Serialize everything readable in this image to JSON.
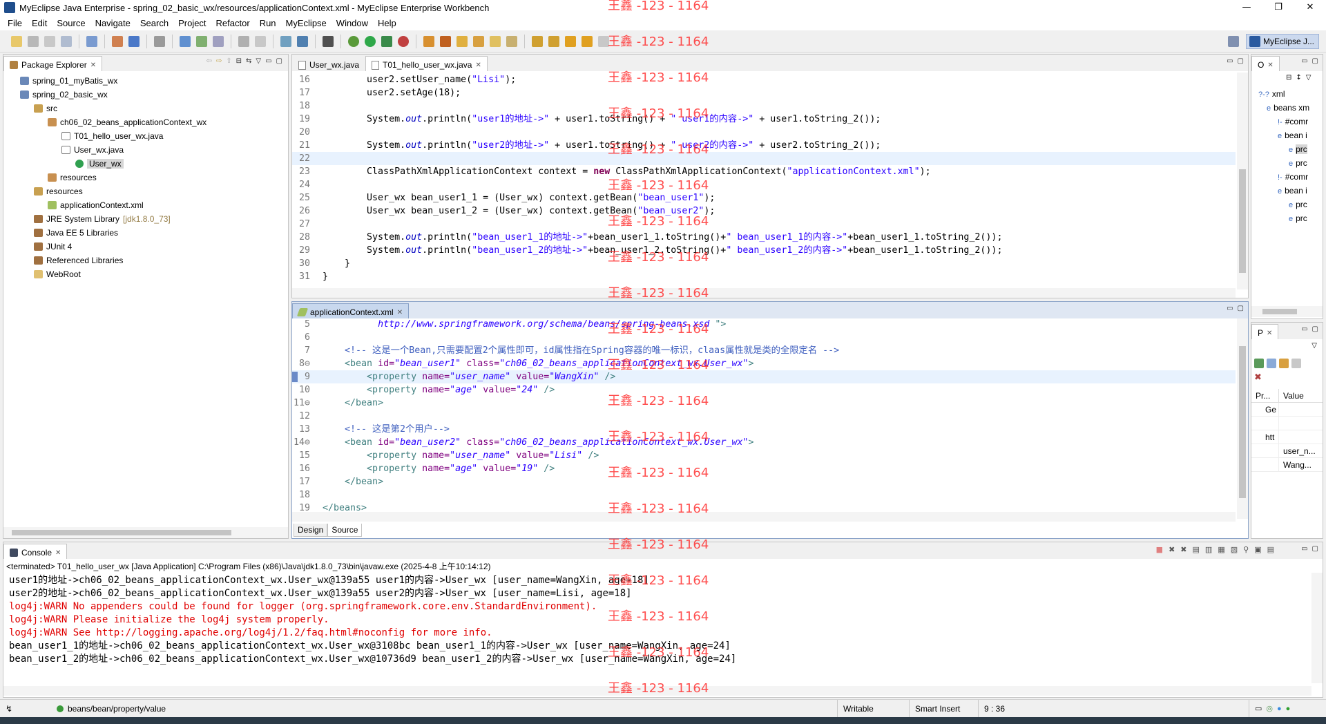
{
  "window": {
    "title": "MyEclipse Java Enterprise - spring_02_basic_wx/resources/applicationContext.xml - MyEclipse Enterprise Workbench",
    "minimize": "—",
    "maximize": "❐",
    "close": "✕"
  },
  "menu": [
    "File",
    "Edit",
    "Source",
    "Navigate",
    "Search",
    "Project",
    "Refactor",
    "Run",
    "MyEclipse",
    "Window",
    "Help"
  ],
  "perspective": {
    "label": "MyEclipse J..."
  },
  "package_explorer": {
    "title": "Package Explorer",
    "items": [
      {
        "label": "spring_01_myBatis_wx",
        "icon": "project-icon",
        "indent": 0
      },
      {
        "label": "spring_02_basic_wx",
        "icon": "project-icon",
        "indent": 0
      },
      {
        "label": "src",
        "icon": "source-folder-icon",
        "indent": 1
      },
      {
        "label": "ch06_02_beans_applicationContext_wx",
        "icon": "package-icon",
        "indent": 2
      },
      {
        "label": "T01_hello_user_wx.java",
        "icon": "java-file-icon",
        "indent": 3
      },
      {
        "label": "User_wx.java",
        "icon": "java-file-icon",
        "indent": 3
      },
      {
        "label": "User_wx",
        "icon": "class-icon",
        "indent": 4,
        "selected": true
      },
      {
        "label": "resources",
        "icon": "package-icon",
        "indent": 2
      },
      {
        "label": "resources",
        "icon": "source-folder-icon",
        "indent": 1
      },
      {
        "label": "applicationContext.xml",
        "icon": "xml-file-icon",
        "indent": 2
      },
      {
        "label": "JRE System Library",
        "suffix": "[jdk1.8.0_73]",
        "icon": "library-icon",
        "indent": 1
      },
      {
        "label": "Java EE 5 Libraries",
        "icon": "library-icon",
        "indent": 1
      },
      {
        "label": "JUnit 4",
        "icon": "library-icon",
        "indent": 1
      },
      {
        "label": "Referenced Libraries",
        "icon": "library-icon",
        "indent": 1
      },
      {
        "label": "WebRoot",
        "icon": "folder-icon",
        "indent": 1
      }
    ]
  },
  "java_editor": {
    "tabs": [
      "User_wx.java",
      "T01_hello_user_wx.java"
    ],
    "lines": [
      {
        "n": "16",
        "html": "        user2.setUser_name(<span class=\"str\">\"Lisi\"</span>);"
      },
      {
        "n": "17",
        "html": "        user2.setAge(18);"
      },
      {
        "n": "18",
        "html": ""
      },
      {
        "n": "19",
        "html": "        System.<span class=\"it\">out</span>.println(<span class=\"str\">\"user1的地址->\"</span> + user1.toString() + <span class=\"str\">\" user1的内容->\"</span> + user1.toString_2());"
      },
      {
        "n": "20",
        "html": ""
      },
      {
        "n": "21",
        "html": "        System.<span class=\"it\">out</span>.println(<span class=\"str\">\"user2的地址->\"</span> + user1.toString() + <span class=\"str\">\" user2的内容->\"</span> + user2.toString_2());"
      },
      {
        "n": "22",
        "html": "",
        "current": true
      },
      {
        "n": "23",
        "html": "        ClassPathXmlApplicationContext context = <span class=\"kw\">new</span> ClassPathXmlApplicationContext(<span class=\"str\">\"applicationContext.xml\"</span>);"
      },
      {
        "n": "24",
        "html": ""
      },
      {
        "n": "25",
        "html": "        User_wx bean_user1_1 = (User_wx) context.getBean(<span class=\"str\">\"bean_user1\"</span>);"
      },
      {
        "n": "26",
        "html": "        User_wx bean_user1_2 = (User_wx) context.getBean(<span class=\"str\">\"bean_user2\"</span>);"
      },
      {
        "n": "27",
        "html": ""
      },
      {
        "n": "28",
        "html": "        System.<span class=\"it\">out</span>.println(<span class=\"str\">\"bean_user1_1的地址->\"</span>+bean_user1_1.toString()+<span class=\"str\">\" bean_user1_1的内容->\"</span>+bean_user1_1.toString_2());"
      },
      {
        "n": "29",
        "html": "        System.<span class=\"it\">out</span>.println(<span class=\"str\">\"bean_user1_2的地址->\"</span>+bean_user1_2.toString()+<span class=\"str\">\" bean_user1_2的内容->\"</span>+bean_user1_1.toString_2());"
      },
      {
        "n": "30",
        "html": "    }"
      },
      {
        "n": "31",
        "html": "}"
      }
    ]
  },
  "xml_editor": {
    "tab": "applicationContext.xml",
    "lines": [
      {
        "n": "5",
        "html": "          <span class=\"val\">http://www.springframework.org/schema/beans/spring-beans.xsd</span> <span class=\"tagc\">\"&gt;</span>"
      },
      {
        "n": "6",
        "html": ""
      },
      {
        "n": "7",
        "html": "    <span class=\"xcm\">&lt;!-- 这是一个Bean,只需要配置2个属性即可，id属性指在Spring容器的唯一标识，claas属性就是类的全限定名 --&gt;</span>"
      },
      {
        "n": "8",
        "fold": true,
        "html": "    <span class=\"tagc\">&lt;bean</span> <span class=\"attr\">id=</span><span class=\"val\">\"bean_user1\"</span> <span class=\"attr\">class=</span><span class=\"val\">\"ch06_02_beans_applicationContext_wx.User_wx\"</span><span class=\"tagc\">&gt;</span>"
      },
      {
        "n": "9",
        "current": true,
        "html": "        <span class=\"tagc\">&lt;property</span> <span class=\"attr\">name=</span><span class=\"val\">\"user_name\"</span> <span class=\"attr\">value=</span><span class=\"val\">\"WangXin\"</span> <span class=\"tagc\">/&gt;</span>"
      },
      {
        "n": "10",
        "html": "        <span class=\"tagc\">&lt;property</span> <span class=\"attr\">name=</span><span class=\"val\">\"age\"</span> <span class=\"attr\">value=</span><span class=\"val\">\"24\"</span> <span class=\"tagc\">/&gt;</span>"
      },
      {
        "n": "11",
        "fold": true,
        "html": "    <span class=\"tagc\">&lt;/bean&gt;</span>"
      },
      {
        "n": "12",
        "html": ""
      },
      {
        "n": "13",
        "html": "    <span class=\"xcm\">&lt;!-- 这是第2个用户--&gt;</span>"
      },
      {
        "n": "14",
        "fold": true,
        "html": "    <span class=\"tagc\">&lt;bean</span> <span class=\"attr\">id=</span><span class=\"val\">\"bean_user2\"</span> <span class=\"attr\">class=</span><span class=\"val\">\"ch06_02_beans_applicationContext_wx.User_wx\"</span><span class=\"tagc\">&gt;</span>"
      },
      {
        "n": "15",
        "html": "        <span class=\"tagc\">&lt;property</span> <span class=\"attr\">name=</span><span class=\"val\">\"user_name\"</span> <span class=\"attr\">value=</span><span class=\"val\">\"Lisi\"</span> <span class=\"tagc\">/&gt;</span>"
      },
      {
        "n": "16",
        "html": "        <span class=\"tagc\">&lt;property</span> <span class=\"attr\">name=</span><span class=\"val\">\"age\"</span> <span class=\"attr\">value=</span><span class=\"val\">\"19\"</span> <span class=\"tagc\">/&gt;</span>"
      },
      {
        "n": "17",
        "html": "    <span class=\"tagc\">&lt;/bean&gt;</span>"
      },
      {
        "n": "18",
        "html": ""
      },
      {
        "n": "19",
        "html": "<span class=\"tagc\">&lt;/beans&gt;</span>"
      }
    ],
    "bottom_tabs": [
      "Design",
      "Source"
    ]
  },
  "outline": {
    "title": "O",
    "items": [
      {
        "label": "xml",
        "prefix": "?-?"
      },
      {
        "label": "beans xm",
        "prefix": "e"
      },
      {
        "label": "#comr",
        "prefix": "!-"
      },
      {
        "label": "bean i",
        "prefix": "e"
      },
      {
        "label": "prc",
        "prefix": "e",
        "selected": true
      },
      {
        "label": "prc",
        "prefix": "e"
      },
      {
        "label": "#comr",
        "prefix": "!-"
      },
      {
        "label": "bean i",
        "prefix": "e"
      },
      {
        "label": "prc",
        "prefix": "e"
      },
      {
        "label": "prc",
        "prefix": "e"
      }
    ]
  },
  "properties": {
    "title": "P",
    "col_property": "Pr...",
    "col_value": "Value",
    "rows": [
      {
        "prop": "Ge",
        "value": ""
      },
      {
        "prop": "",
        "value": ""
      },
      {
        "prop": "htt",
        "value": ""
      },
      {
        "prop": "",
        "value": "user_n..."
      },
      {
        "prop": "",
        "value": "Wang..."
      }
    ]
  },
  "console": {
    "title": "Console",
    "header": "<terminated> T01_hello_user_wx [Java Application] C:\\Program Files (x86)\\Java\\jdk1.8.0_73\\bin\\javaw.exe (2025-4-8 上午10:14:12)",
    "lines": [
      {
        "text": "user1的地址->ch06_02_beans_applicationContext_wx.User_wx@139a55 user1的内容->User_wx [user_name=WangXin, age=18]",
        "error": false
      },
      {
        "text": "user2的地址->ch06_02_beans_applicationContext_wx.User_wx@139a55 user2的内容->User_wx [user_name=Lisi, age=18]",
        "error": false
      },
      {
        "text": "log4j:WARN No appenders could be found for logger (org.springframework.core.env.StandardEnvironment).",
        "error": true
      },
      {
        "text": "log4j:WARN Please initialize the log4j system properly.",
        "error": true
      },
      {
        "text": "log4j:WARN See http://logging.apache.org/log4j/1.2/faq.html#noconfig for more info.",
        "error": true
      },
      {
        "text": "bean_user1_1的地址->ch06_02_beans_applicationContext_wx.User_wx@3108bc bean_user1_1的内容->User_wx [user_name=WangXin, age=24]",
        "error": false
      },
      {
        "text": "bean_user1_2的地址->ch06_02_beans_applicationContext_wx.User_wx@10736d9 bean_user1_2的内容->User_wx [user_name=WangXin, age=24]",
        "error": false
      }
    ]
  },
  "statusbar": {
    "path": "beans/bean/property/value",
    "writable": "Writable",
    "insert_mode": "Smart Insert",
    "position": "9 : 36"
  },
  "watermark": "王鑫 -123 - 1164",
  "colors": {
    "string": "#2a00ff",
    "keyword": "#7f0055",
    "error": "#e00000",
    "watermark": "#ff3030"
  }
}
